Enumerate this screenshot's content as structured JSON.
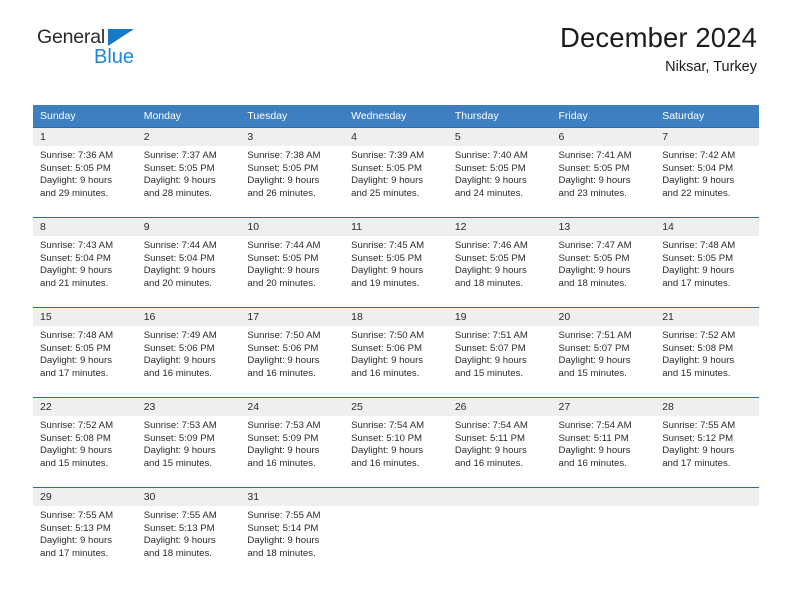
{
  "brand": {
    "name_top": "General",
    "name_bottom": "Blue"
  },
  "header": {
    "title": "December 2024",
    "subtitle": "Niksar, Turkey"
  },
  "colors": {
    "header_blue": "#3d7fc1",
    "row_border_blue": "#2a6aad",
    "daynum_band": "#efefef",
    "brand_blue": "#1c87d8",
    "text": "#2b2b2b"
  },
  "weekday_headers": [
    "Sunday",
    "Monday",
    "Tuesday",
    "Wednesday",
    "Thursday",
    "Friday",
    "Saturday"
  ],
  "weeks": [
    [
      {
        "day": "1",
        "sunrise": "Sunrise: 7:36 AM",
        "sunset": "Sunset: 5:05 PM",
        "daylight1": "Daylight: 9 hours",
        "daylight2": "and 29 minutes."
      },
      {
        "day": "2",
        "sunrise": "Sunrise: 7:37 AM",
        "sunset": "Sunset: 5:05 PM",
        "daylight1": "Daylight: 9 hours",
        "daylight2": "and 28 minutes."
      },
      {
        "day": "3",
        "sunrise": "Sunrise: 7:38 AM",
        "sunset": "Sunset: 5:05 PM",
        "daylight1": "Daylight: 9 hours",
        "daylight2": "and 26 minutes."
      },
      {
        "day": "4",
        "sunrise": "Sunrise: 7:39 AM",
        "sunset": "Sunset: 5:05 PM",
        "daylight1": "Daylight: 9 hours",
        "daylight2": "and 25 minutes."
      },
      {
        "day": "5",
        "sunrise": "Sunrise: 7:40 AM",
        "sunset": "Sunset: 5:05 PM",
        "daylight1": "Daylight: 9 hours",
        "daylight2": "and 24 minutes."
      },
      {
        "day": "6",
        "sunrise": "Sunrise: 7:41 AM",
        "sunset": "Sunset: 5:05 PM",
        "daylight1": "Daylight: 9 hours",
        "daylight2": "and 23 minutes."
      },
      {
        "day": "7",
        "sunrise": "Sunrise: 7:42 AM",
        "sunset": "Sunset: 5:04 PM",
        "daylight1": "Daylight: 9 hours",
        "daylight2": "and 22 minutes."
      }
    ],
    [
      {
        "day": "8",
        "sunrise": "Sunrise: 7:43 AM",
        "sunset": "Sunset: 5:04 PM",
        "daylight1": "Daylight: 9 hours",
        "daylight2": "and 21 minutes."
      },
      {
        "day": "9",
        "sunrise": "Sunrise: 7:44 AM",
        "sunset": "Sunset: 5:04 PM",
        "daylight1": "Daylight: 9 hours",
        "daylight2": "and 20 minutes."
      },
      {
        "day": "10",
        "sunrise": "Sunrise: 7:44 AM",
        "sunset": "Sunset: 5:05 PM",
        "daylight1": "Daylight: 9 hours",
        "daylight2": "and 20 minutes."
      },
      {
        "day": "11",
        "sunrise": "Sunrise: 7:45 AM",
        "sunset": "Sunset: 5:05 PM",
        "daylight1": "Daylight: 9 hours",
        "daylight2": "and 19 minutes."
      },
      {
        "day": "12",
        "sunrise": "Sunrise: 7:46 AM",
        "sunset": "Sunset: 5:05 PM",
        "daylight1": "Daylight: 9 hours",
        "daylight2": "and 18 minutes."
      },
      {
        "day": "13",
        "sunrise": "Sunrise: 7:47 AM",
        "sunset": "Sunset: 5:05 PM",
        "daylight1": "Daylight: 9 hours",
        "daylight2": "and 18 minutes."
      },
      {
        "day": "14",
        "sunrise": "Sunrise: 7:48 AM",
        "sunset": "Sunset: 5:05 PM",
        "daylight1": "Daylight: 9 hours",
        "daylight2": "and 17 minutes."
      }
    ],
    [
      {
        "day": "15",
        "sunrise": "Sunrise: 7:48 AM",
        "sunset": "Sunset: 5:05 PM",
        "daylight1": "Daylight: 9 hours",
        "daylight2": "and 17 minutes."
      },
      {
        "day": "16",
        "sunrise": "Sunrise: 7:49 AM",
        "sunset": "Sunset: 5:06 PM",
        "daylight1": "Daylight: 9 hours",
        "daylight2": "and 16 minutes."
      },
      {
        "day": "17",
        "sunrise": "Sunrise: 7:50 AM",
        "sunset": "Sunset: 5:06 PM",
        "daylight1": "Daylight: 9 hours",
        "daylight2": "and 16 minutes."
      },
      {
        "day": "18",
        "sunrise": "Sunrise: 7:50 AM",
        "sunset": "Sunset: 5:06 PM",
        "daylight1": "Daylight: 9 hours",
        "daylight2": "and 16 minutes."
      },
      {
        "day": "19",
        "sunrise": "Sunrise: 7:51 AM",
        "sunset": "Sunset: 5:07 PM",
        "daylight1": "Daylight: 9 hours",
        "daylight2": "and 15 minutes."
      },
      {
        "day": "20",
        "sunrise": "Sunrise: 7:51 AM",
        "sunset": "Sunset: 5:07 PM",
        "daylight1": "Daylight: 9 hours",
        "daylight2": "and 15 minutes."
      },
      {
        "day": "21",
        "sunrise": "Sunrise: 7:52 AM",
        "sunset": "Sunset: 5:08 PM",
        "daylight1": "Daylight: 9 hours",
        "daylight2": "and 15 minutes."
      }
    ],
    [
      {
        "day": "22",
        "sunrise": "Sunrise: 7:52 AM",
        "sunset": "Sunset: 5:08 PM",
        "daylight1": "Daylight: 9 hours",
        "daylight2": "and 15 minutes."
      },
      {
        "day": "23",
        "sunrise": "Sunrise: 7:53 AM",
        "sunset": "Sunset: 5:09 PM",
        "daylight1": "Daylight: 9 hours",
        "daylight2": "and 15 minutes."
      },
      {
        "day": "24",
        "sunrise": "Sunrise: 7:53 AM",
        "sunset": "Sunset: 5:09 PM",
        "daylight1": "Daylight: 9 hours",
        "daylight2": "and 16 minutes."
      },
      {
        "day": "25",
        "sunrise": "Sunrise: 7:54 AM",
        "sunset": "Sunset: 5:10 PM",
        "daylight1": "Daylight: 9 hours",
        "daylight2": "and 16 minutes."
      },
      {
        "day": "26",
        "sunrise": "Sunrise: 7:54 AM",
        "sunset": "Sunset: 5:11 PM",
        "daylight1": "Daylight: 9 hours",
        "daylight2": "and 16 minutes."
      },
      {
        "day": "27",
        "sunrise": "Sunrise: 7:54 AM",
        "sunset": "Sunset: 5:11 PM",
        "daylight1": "Daylight: 9 hours",
        "daylight2": "and 16 minutes."
      },
      {
        "day": "28",
        "sunrise": "Sunrise: 7:55 AM",
        "sunset": "Sunset: 5:12 PM",
        "daylight1": "Daylight: 9 hours",
        "daylight2": "and 17 minutes."
      }
    ],
    [
      {
        "day": "29",
        "sunrise": "Sunrise: 7:55 AM",
        "sunset": "Sunset: 5:13 PM",
        "daylight1": "Daylight: 9 hours",
        "daylight2": "and 17 minutes."
      },
      {
        "day": "30",
        "sunrise": "Sunrise: 7:55 AM",
        "sunset": "Sunset: 5:13 PM",
        "daylight1": "Daylight: 9 hours",
        "daylight2": "and 18 minutes."
      },
      {
        "day": "31",
        "sunrise": "Sunrise: 7:55 AM",
        "sunset": "Sunset: 5:14 PM",
        "daylight1": "Daylight: 9 hours",
        "daylight2": "and 18 minutes."
      },
      {
        "day": "",
        "sunrise": "",
        "sunset": "",
        "daylight1": "",
        "daylight2": ""
      },
      {
        "day": "",
        "sunrise": "",
        "sunset": "",
        "daylight1": "",
        "daylight2": ""
      },
      {
        "day": "",
        "sunrise": "",
        "sunset": "",
        "daylight1": "",
        "daylight2": ""
      },
      {
        "day": "",
        "sunrise": "",
        "sunset": "",
        "daylight1": "",
        "daylight2": ""
      }
    ]
  ]
}
